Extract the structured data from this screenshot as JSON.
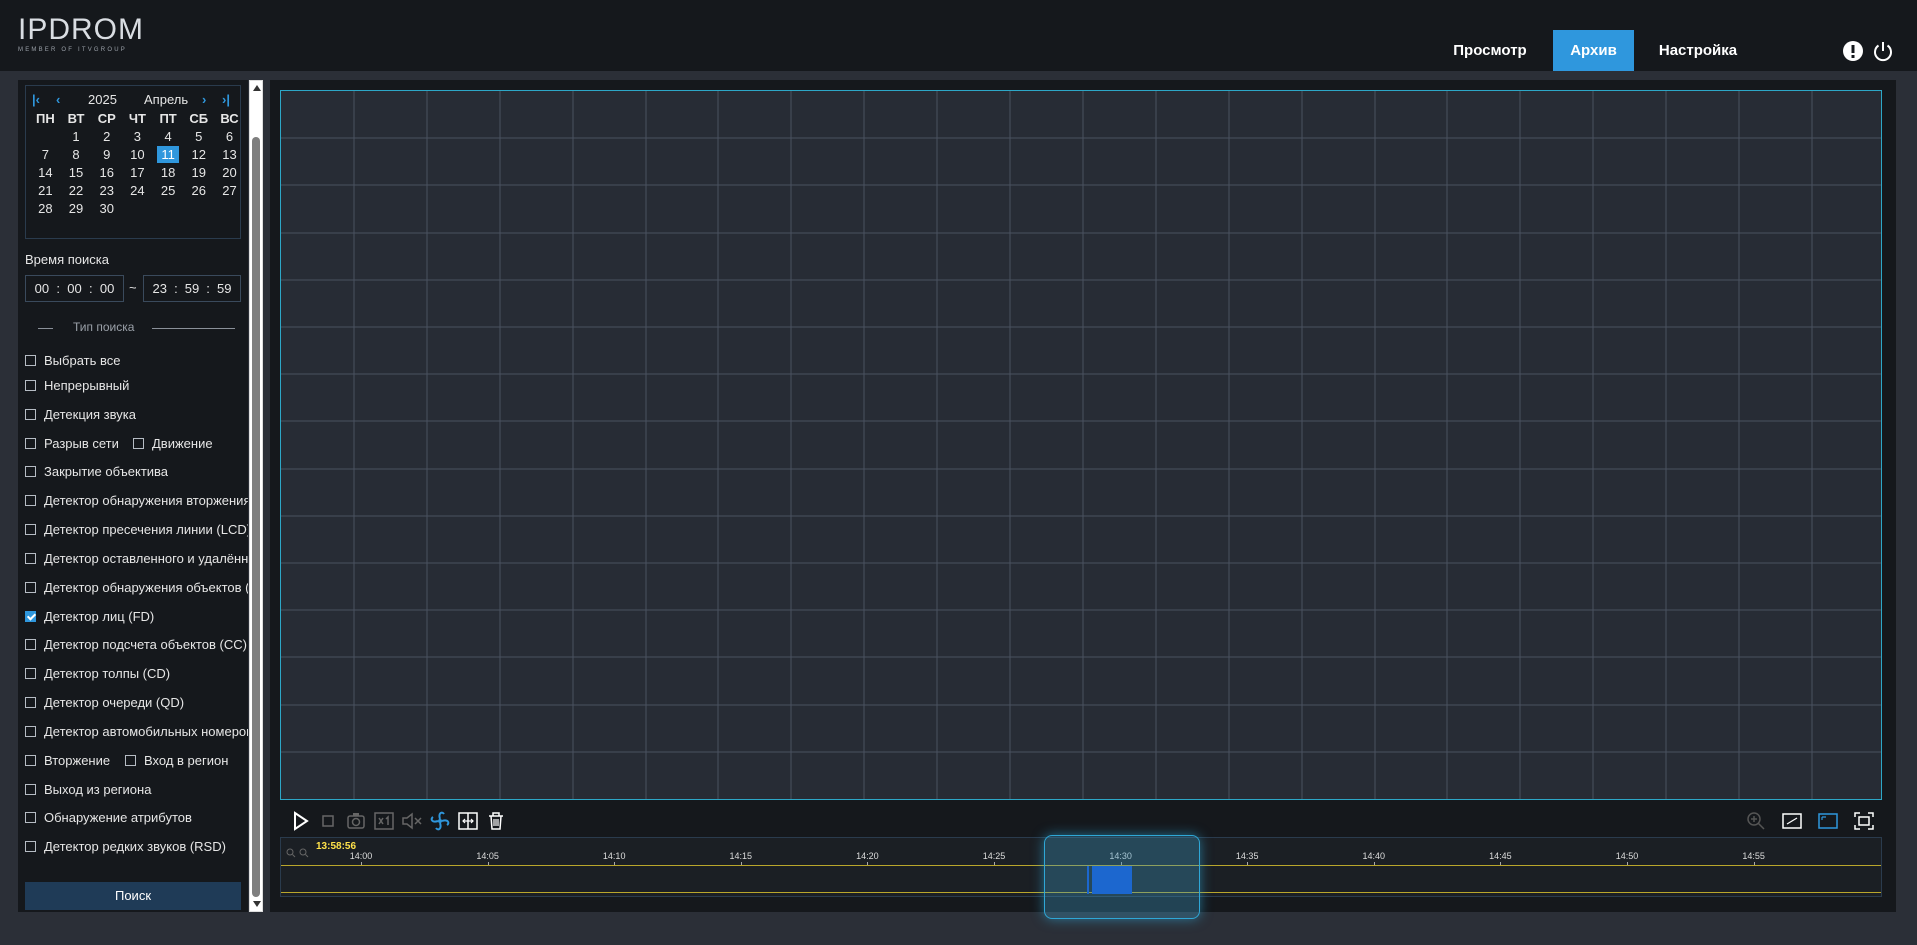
{
  "brand": {
    "name": "IPDROM",
    "tagline": "MEMBER OF ITVGROUP"
  },
  "nav": {
    "view": "Просмотр",
    "archive": "Архив",
    "settings": "Настройка"
  },
  "calendar": {
    "year": "2025",
    "month": "Апрель",
    "weekdays": [
      "ПН",
      "ВТ",
      "СР",
      "ЧТ",
      "ПТ",
      "СБ",
      "ВС"
    ],
    "days": [
      "",
      "1",
      "2",
      "3",
      "4",
      "5",
      "6",
      "7",
      "8",
      "9",
      "10",
      "11",
      "12",
      "13",
      "14",
      "15",
      "16",
      "17",
      "18",
      "19",
      "20",
      "21",
      "22",
      "23",
      "24",
      "25",
      "26",
      "27",
      "28",
      "29",
      "30"
    ],
    "selected": "11"
  },
  "search_time": {
    "label": "Время поиска",
    "start": {
      "h": "00",
      "m": "00",
      "s": "00"
    },
    "end": {
      "h": "23",
      "m": "59",
      "s": "59"
    },
    "separator": "~"
  },
  "search_type": {
    "title": "Тип поиска",
    "items": [
      {
        "label": "Выбрать все",
        "checked": false
      },
      {
        "label": "Непрерывный",
        "checked": false
      },
      {
        "label": "Детекция звука",
        "checked": false
      },
      {
        "label": "Разрыв сети",
        "checked": false
      },
      {
        "label": "Движение",
        "checked": false
      },
      {
        "label": "Закрытие объектива",
        "checked": false
      },
      {
        "label": "Детектор обнаружения вторжения",
        "checked": false
      },
      {
        "label": "Детектор пресечения линии (LCD)",
        "checked": false
      },
      {
        "label": "Детектор оставленного и удалённого",
        "checked": false
      },
      {
        "label": "Детектор обнаружения объектов (I",
        "checked": false
      },
      {
        "label": "Детектор лиц (FD)",
        "checked": true
      },
      {
        "label": "Детектор подсчета объектов (CC)",
        "checked": false
      },
      {
        "label": "Детектор толпы (CD)",
        "checked": false
      },
      {
        "label": "Детектор очереди (QD)",
        "checked": false
      },
      {
        "label": "Детектор автомобильных номеров",
        "checked": false
      },
      {
        "label": "Вторжение",
        "checked": false
      },
      {
        "label": "Вход в регион",
        "checked": false
      },
      {
        "label": "Выход из региона",
        "checked": false
      },
      {
        "label": "Обнаружение атрибутов",
        "checked": false
      },
      {
        "label": "Детектор редких звуков (RSD)",
        "checked": false
      }
    ]
  },
  "search_button": "Поиск",
  "timeline": {
    "current_time": "13:58:56",
    "ticks": [
      "14:00",
      "14:05",
      "14:10",
      "14:15",
      "14:20",
      "14:25",
      "14:30",
      "14:35",
      "14:40",
      "14:45",
      "14:50",
      "14:55"
    ]
  },
  "colors": {
    "accent": "#2f97dd",
    "record": "#0b4fd9",
    "cursor": "#ffe24a"
  }
}
